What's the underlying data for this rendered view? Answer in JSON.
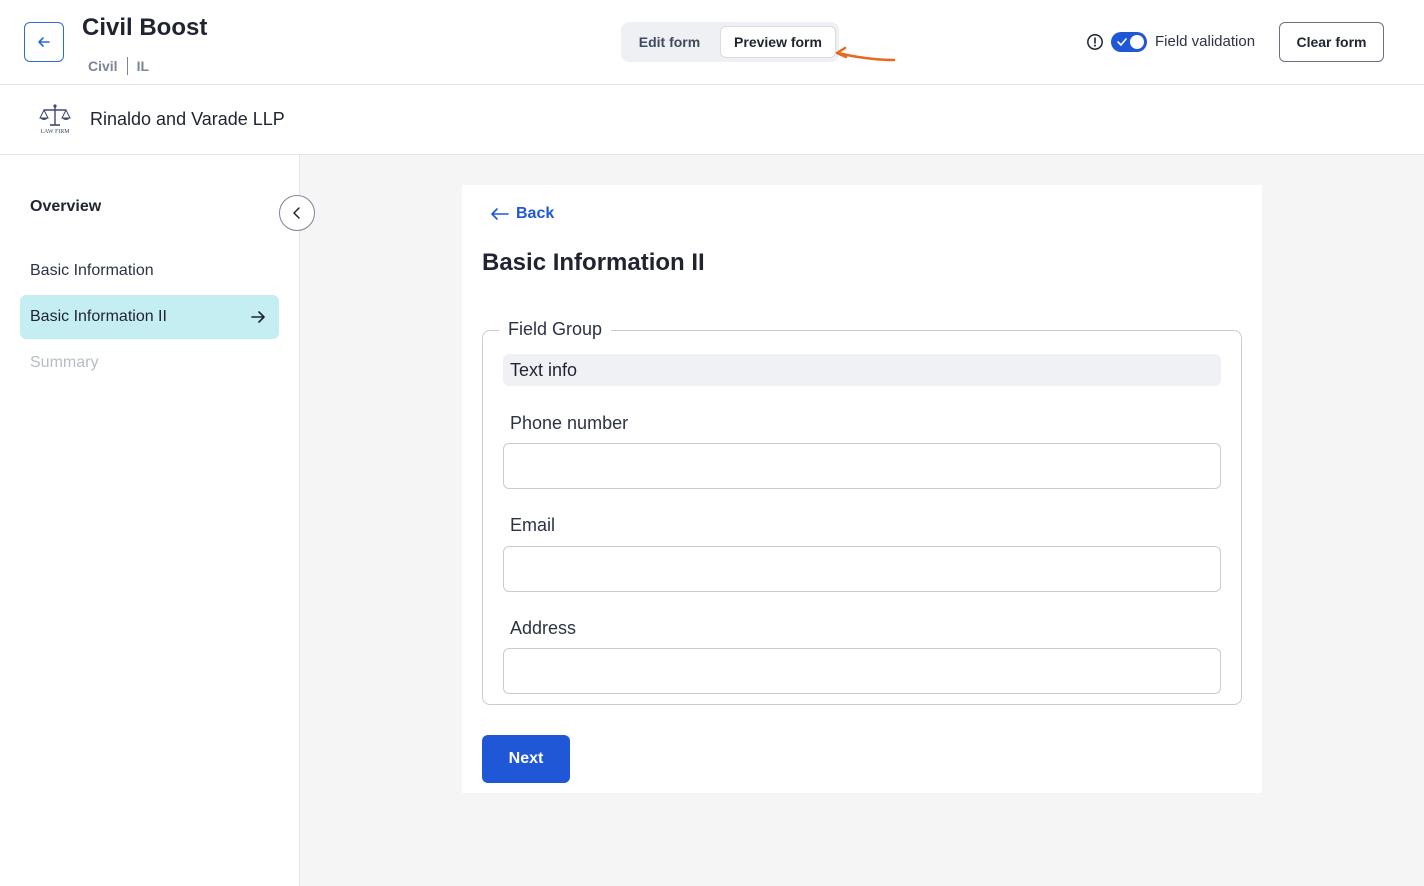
{
  "header": {
    "title": "Civil Boost",
    "breadcrumb": [
      "Civil",
      "IL"
    ],
    "tabs": {
      "edit_label": "Edit form",
      "preview_label": "Preview form",
      "active": "preview"
    },
    "field_validation": {
      "label": "Field validation",
      "enabled": true
    },
    "clear_label": "Clear form"
  },
  "firm": {
    "name": "Rinaldo and Varade LLP",
    "logo_text": "LAW FIRM"
  },
  "sidebar": {
    "heading": "Overview",
    "items": [
      {
        "label": "Basic Information",
        "state": "default"
      },
      {
        "label": "Basic Information II",
        "state": "active"
      },
      {
        "label": "Summary",
        "state": "disabled"
      }
    ]
  },
  "form": {
    "back_label": "Back",
    "title": "Basic Information II",
    "group": {
      "legend": "Field Group",
      "text_info": "Text info",
      "fields": [
        {
          "label": "Phone number",
          "value": ""
        },
        {
          "label": "Email",
          "value": ""
        },
        {
          "label": "Address",
          "value": ""
        }
      ]
    },
    "next_label": "Next"
  },
  "colors": {
    "primary": "#1f57d6",
    "active_nav": "#c5eef3",
    "annotation_arrow": "#e8681f"
  }
}
